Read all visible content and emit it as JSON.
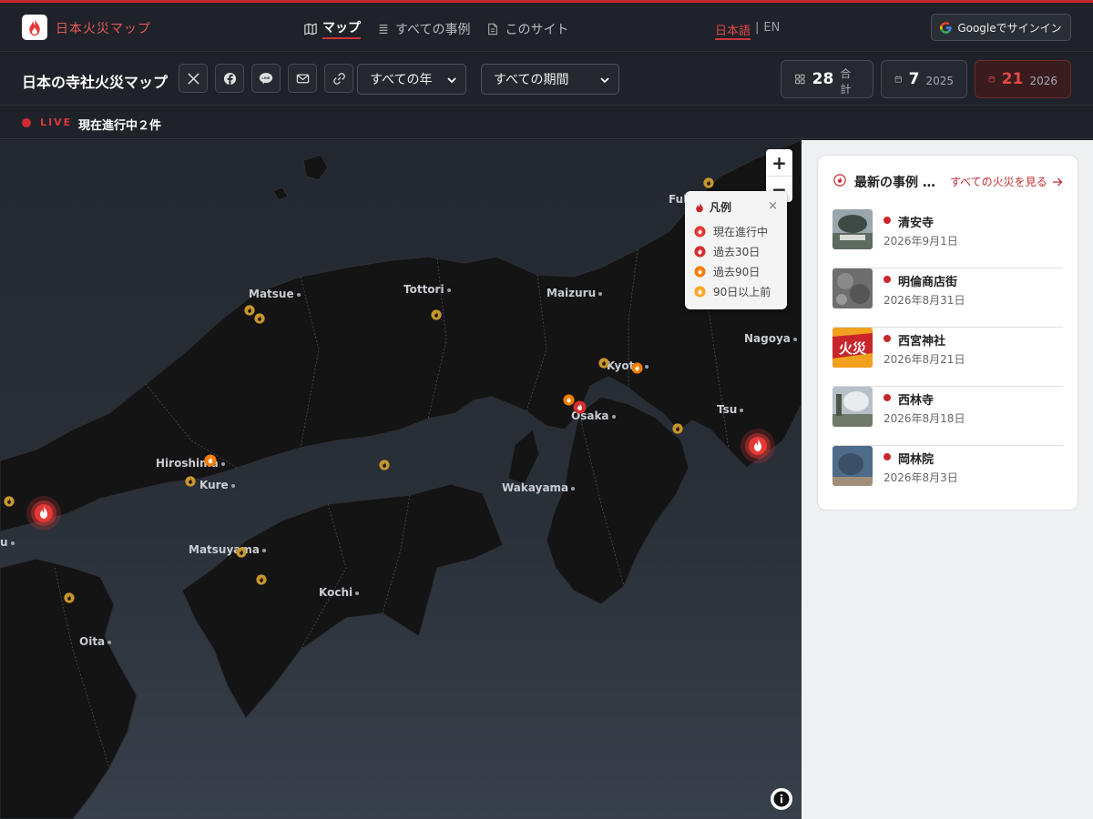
{
  "app": {
    "logo_text": "日本火災マップ"
  },
  "nav": [
    {
      "label": "マップ",
      "icon": "map-icon",
      "active": true
    },
    {
      "label": "すべての事例",
      "icon": "list-icon",
      "active": false
    },
    {
      "label": "このサイト",
      "icon": "document-icon",
      "active": false
    }
  ],
  "lang": {
    "ja": "日本語",
    "sep": "|",
    "en": "EN"
  },
  "signin": {
    "label": "Googleでサインイン"
  },
  "toolbar": {
    "title": "日本の寺社火災マップ",
    "year_select": "すべての年",
    "period_select": "すべての期間"
  },
  "stats": {
    "total": {
      "value": "28",
      "label": "合計"
    },
    "y2025": {
      "value": "7",
      "label": "2025"
    },
    "y2026": {
      "value": "21",
      "label": "2026"
    }
  },
  "live": {
    "badge": "LIVE",
    "text": "現在進行中２件"
  },
  "map": {
    "cities": [
      "Matsue",
      "Tottori",
      "Maizuru",
      "Kyoto",
      "Osaka",
      "Nagoya",
      "Tsu",
      "Hiroshima",
      "Kure",
      "Wakayama",
      "Matsuyama",
      "Kochi",
      "Oita",
      "Fuk",
      "u"
    ],
    "zoom_in": "+",
    "zoom_out": "−"
  },
  "legend": {
    "title": "凡例",
    "close": "×",
    "items": [
      {
        "label": "現在進行中",
        "color": "#e53935"
      },
      {
        "label": "過去30日",
        "color": "#d32f2f"
      },
      {
        "label": "過去90日",
        "color": "#f57c00"
      },
      {
        "label": "90日以上前",
        "color": "#f9a825"
      }
    ]
  },
  "sidebar": {
    "title": "最新の事例 …",
    "link": "すべての火災を見る",
    "items": [
      {
        "name": "清安寺",
        "date": "2026年9月1日"
      },
      {
        "name": "明倫商店街",
        "date": "2026年8月31日"
      },
      {
        "name": "西宮神社",
        "date": "2026年8月21日",
        "thumb_text": "火災"
      },
      {
        "name": "西林寺",
        "date": "2026年8月18日"
      },
      {
        "name": "岡林院",
        "date": "2026年8月3日"
      }
    ]
  }
}
